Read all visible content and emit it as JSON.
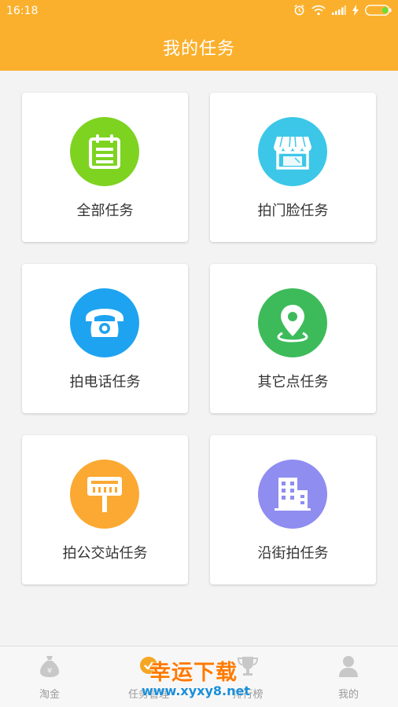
{
  "status_bar": {
    "time": "16:18"
  },
  "header": {
    "title": "我的任务"
  },
  "tasks": [
    {
      "label": "全部任务",
      "icon": "calendar-icon",
      "color": "#7ed321"
    },
    {
      "label": "拍门脸任务",
      "icon": "storefront-icon",
      "color": "#3cc7e8"
    },
    {
      "label": "拍电话任务",
      "icon": "telephone-icon",
      "color": "#1ea3f0"
    },
    {
      "label": "其它点任务",
      "icon": "location-pin-icon",
      "color": "#3dbb5a"
    },
    {
      "label": "拍公交站任务",
      "icon": "bus-stop-icon",
      "color": "#fba932"
    },
    {
      "label": "沿街拍任务",
      "icon": "building-icon",
      "color": "#8f8df0"
    }
  ],
  "bottom_nav": [
    {
      "label": "淘金",
      "icon": "money-bag-icon"
    },
    {
      "label": "任务管理",
      "icon": "task-icon"
    },
    {
      "label": "排行榜",
      "icon": "trophy-icon"
    },
    {
      "label": "我的",
      "icon": "user-icon"
    }
  ],
  "watermark": {
    "title": "幸运下载",
    "url": "www.xyxy8.net"
  },
  "colors": {
    "header_bg": "#fbb02d",
    "page_bg": "#f3f3f3"
  }
}
